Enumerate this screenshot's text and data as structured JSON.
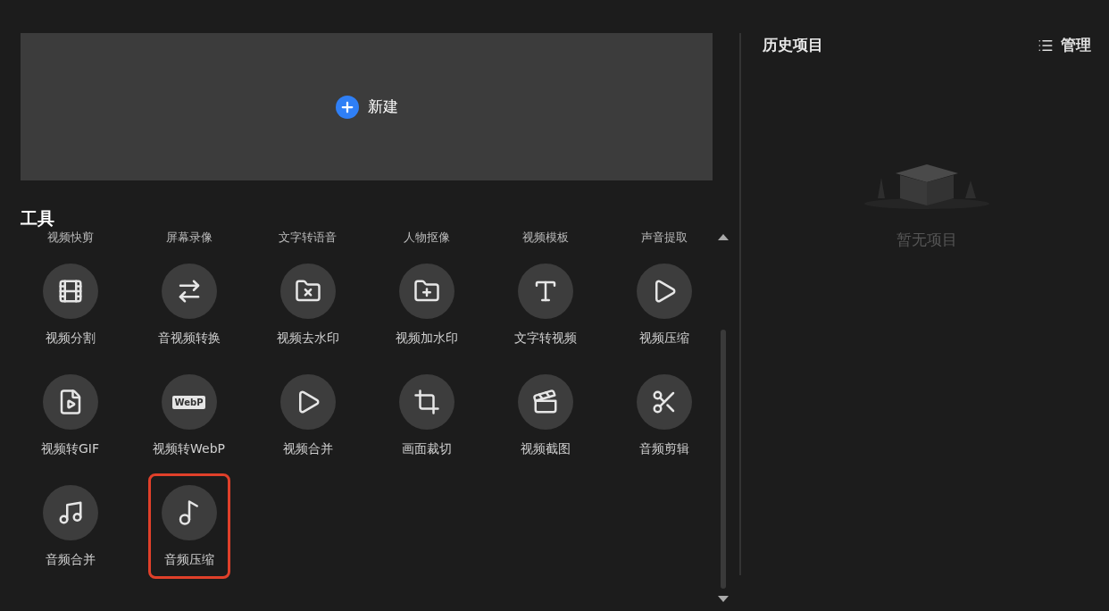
{
  "new_project": {
    "label": "新建"
  },
  "tools": {
    "title": "工具",
    "items": [
      {
        "kind": "label_only",
        "label": "视频快剪"
      },
      {
        "kind": "label_only",
        "label": "屏幕录像"
      },
      {
        "kind": "label_only",
        "label": "文字转语音"
      },
      {
        "kind": "label_only",
        "label": "人物抠像"
      },
      {
        "kind": "label_only",
        "label": "视频模板"
      },
      {
        "kind": "label_only",
        "label": "声音提取"
      },
      {
        "kind": "icon",
        "label": "视频分割",
        "highlighted": false
      },
      {
        "kind": "icon",
        "label": "音视频转换",
        "highlighted": false
      },
      {
        "kind": "icon",
        "label": "视频去水印",
        "highlighted": false
      },
      {
        "kind": "icon",
        "label": "视频加水印",
        "highlighted": false
      },
      {
        "kind": "icon",
        "label": "文字转视频",
        "highlighted": false
      },
      {
        "kind": "icon",
        "label": "视频压缩",
        "highlighted": false
      },
      {
        "kind": "icon",
        "label": "视频转GIF",
        "highlighted": false
      },
      {
        "kind": "icon",
        "label": "视频转WebP",
        "highlighted": false,
        "badge": "WebP"
      },
      {
        "kind": "icon",
        "label": "视频合并",
        "highlighted": false
      },
      {
        "kind": "icon",
        "label": "画面裁切",
        "highlighted": false
      },
      {
        "kind": "icon",
        "label": "视频截图",
        "highlighted": false
      },
      {
        "kind": "icon",
        "label": "音频剪辑",
        "highlighted": false
      },
      {
        "kind": "icon",
        "label": "音频合并",
        "highlighted": false
      },
      {
        "kind": "icon",
        "label": "音频压缩",
        "highlighted": true
      }
    ]
  },
  "history": {
    "title": "历史项目",
    "manage_button": "管理",
    "empty_text": "暂无项目"
  }
}
